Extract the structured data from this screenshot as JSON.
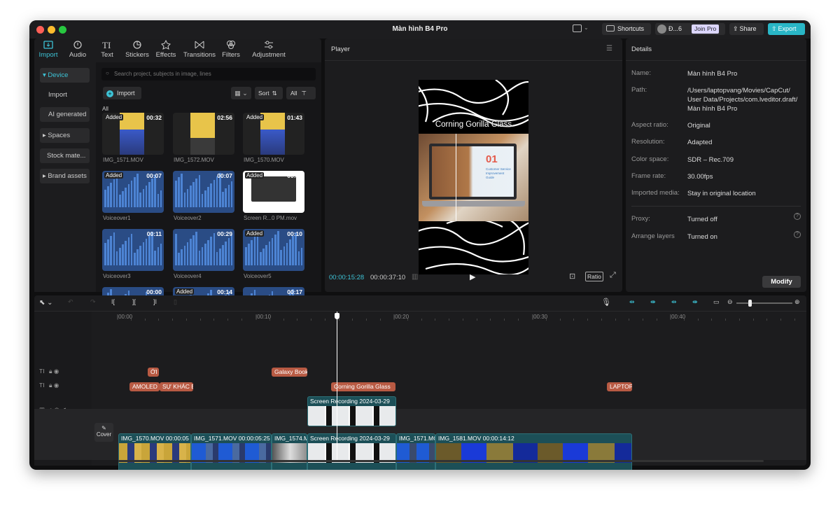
{
  "window": {
    "title": "Màn hình B4 Pro"
  },
  "topbar": {
    "shortcuts": "Shortcuts",
    "user": "Đ...6",
    "join_pro": "Join Pro",
    "share": "Share",
    "export": "Export"
  },
  "media_tabs": [
    {
      "label": "Import",
      "icon": "import-icon"
    },
    {
      "label": "Audio",
      "icon": "audio-icon"
    },
    {
      "label": "Text",
      "icon": "text-icon"
    },
    {
      "label": "Stickers",
      "icon": "stickers-icon"
    },
    {
      "label": "Effects",
      "icon": "effects-icon"
    },
    {
      "label": "Transitions",
      "icon": "transitions-icon"
    },
    {
      "label": "Filters",
      "icon": "filters-icon"
    },
    {
      "label": "Adjustment",
      "icon": "adjustment-icon"
    }
  ],
  "sidebar": [
    "▾ Device",
    "Import",
    "AI generated",
    "▸ Spaces",
    "Stock mate...",
    "▸ Brand assets"
  ],
  "search": {
    "placeholder": "Search project, subjects in image, lines"
  },
  "library": {
    "import": "Import",
    "sort": "Sort",
    "all": "All",
    "section": "All",
    "items": [
      {
        "name": "IMG_1571.MOV",
        "dur": "00:32",
        "added": "Added"
      },
      {
        "name": "IMG_1572.MOV",
        "dur": "02:56",
        "added": ""
      },
      {
        "name": "IMG_1570.MOV",
        "dur": "01:43",
        "added": "Added"
      },
      {
        "name": "Voiceover1",
        "dur": "00:07",
        "added": "Added"
      },
      {
        "name": "Voiceover2",
        "dur": "00:07",
        "added": ""
      },
      {
        "name": "Screen R...0 PM.mov",
        "dur": "00:30",
        "added": "Added"
      },
      {
        "name": "Voiceover3",
        "dur": "00:11",
        "added": ""
      },
      {
        "name": "Voiceover4",
        "dur": "00:29",
        "added": ""
      },
      {
        "name": "Voiceover5",
        "dur": "00:10",
        "added": "Added"
      },
      {
        "name": "",
        "dur": "00:00",
        "added": ""
      },
      {
        "name": "",
        "dur": "00:14",
        "added": "Added"
      },
      {
        "name": "",
        "dur": "00:17",
        "added": ""
      }
    ]
  },
  "player": {
    "title": "Player",
    "overlay_text": "Corning Gorilla Glass",
    "current": "00:00:15:28",
    "total": "00:00:37:10",
    "ratio": "Ratio",
    "screen_number": "01",
    "screen_text": "Customer Service Improvement Guide"
  },
  "details": {
    "title": "Details",
    "rows": [
      {
        "label": "Name:",
        "value": "Màn hình B4 Pro"
      },
      {
        "label": "Path:",
        "value": "/Users/laptopvang/Movies/CapCut/\nUser Data/Projects/com.lveditor.draft/\nMàn hình B4 Pro"
      },
      {
        "label": "Aspect ratio:",
        "value": "Original"
      },
      {
        "label": "Resolution:",
        "value": "Adapted"
      },
      {
        "label": "Color space:",
        "value": "SDR – Rec.709"
      },
      {
        "label": "Frame rate:",
        "value": "30.00fps"
      },
      {
        "label": "Imported media:",
        "value": "Stay in original location"
      },
      {
        "label": "Proxy:",
        "value": "Turned off"
      },
      {
        "label": "Arrange layers",
        "value": "Turned on"
      }
    ],
    "modify": "Modify"
  },
  "timeline": {
    "ruler": [
      "|00:00",
      "|00:10",
      "|00:20",
      "|00:30",
      "|00:40"
    ],
    "cover": "Cover",
    "text_clips_row1": [
      {
        "label": "ỚI"
      },
      {
        "label": "Galaxy Book"
      }
    ],
    "text_clips_row2": [
      {
        "label": "AMOLED"
      },
      {
        "label": "SỰ KHÁC B"
      },
      {
        "label": "Corning Gorilla Glass"
      },
      {
        "label": "LAPTOP"
      }
    ],
    "overlay_clip": "Screen Recording 2024-03-29",
    "main_clips": [
      {
        "label": "IMG_1570.MOV   00:00:05"
      },
      {
        "label": "IMG_1571.MOV   00:00:05:25"
      },
      {
        "label": "IMG_1574.M"
      },
      {
        "label": "Screen Recording 2024-03-29"
      },
      {
        "label": "IMG_1571.MC"
      },
      {
        "label": "IMG_1581.MOV   00:00:14:12"
      }
    ]
  }
}
